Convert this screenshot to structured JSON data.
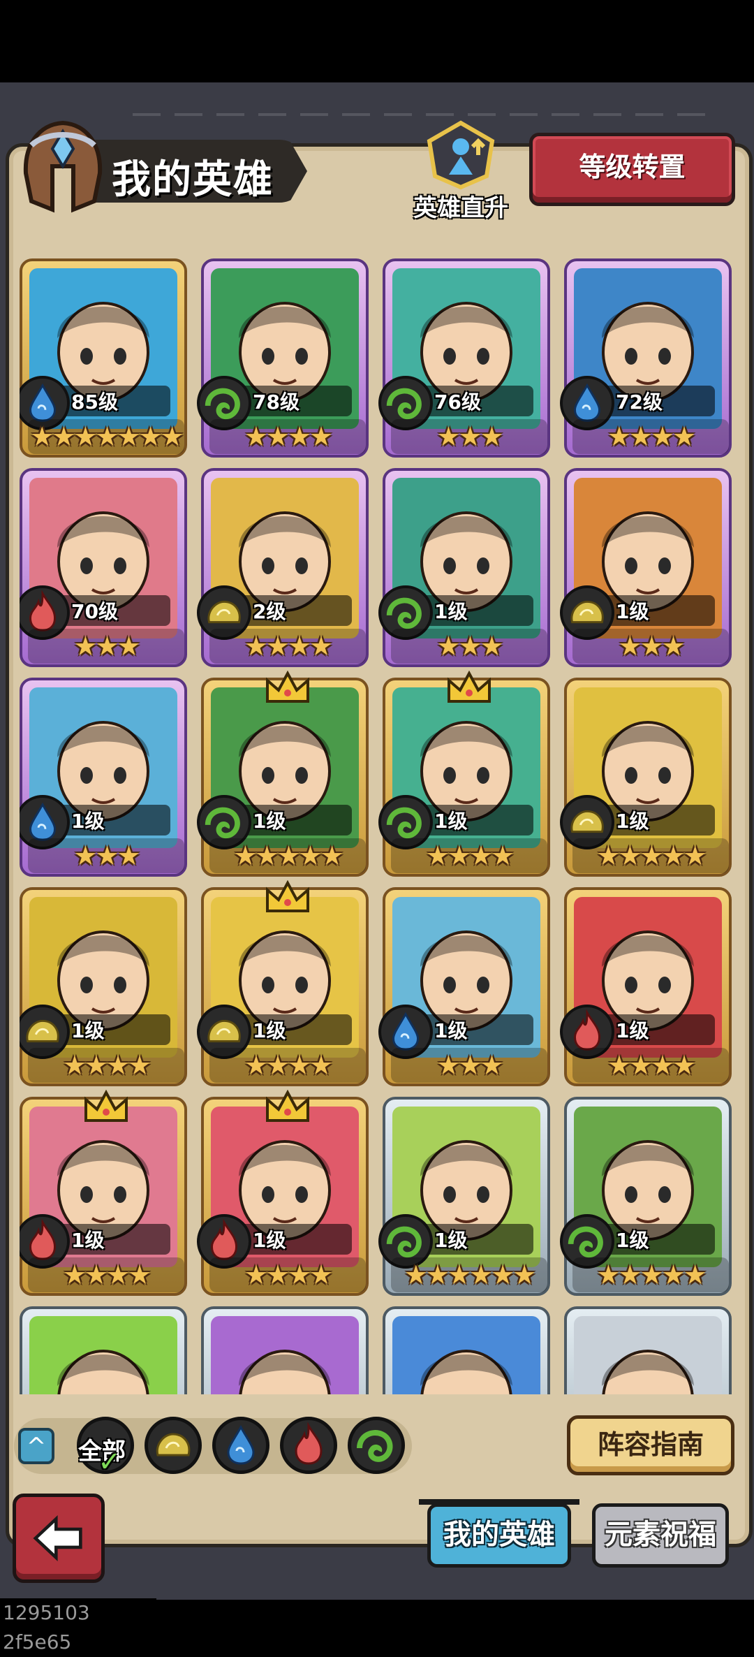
{
  "header": {
    "title": "我的英雄",
    "hero_upgrade_label": "英雄直升",
    "level_transfer_label": "等级转置"
  },
  "colors": {
    "water": "#3f8fd8",
    "nature": "#5fb83a",
    "fire": "#e05a5a",
    "earth": "#d8c04a",
    "accent_red": "#b3333d",
    "tab_active": "#4fb2d8"
  },
  "heroes": [
    {
      "level_label": "85级",
      "element": "water",
      "stars": "★★★★★★★",
      "frame": "gold",
      "crown": false,
      "bg": "#3ea7d8"
    },
    {
      "level_label": "78级",
      "element": "nature",
      "stars": "★★★★",
      "frame": "purple",
      "crown": false,
      "bg": "#3c9c5a"
    },
    {
      "level_label": "76级",
      "element": "nature",
      "stars": "★★★",
      "frame": "purple",
      "crown": false,
      "bg": "#44b0a0"
    },
    {
      "level_label": "72级",
      "element": "water",
      "stars": "★★★★",
      "frame": "purple",
      "crown": false,
      "bg": "#3e86c8"
    },
    {
      "level_label": "70级",
      "element": "fire",
      "stars": "★★★",
      "frame": "purple",
      "crown": false,
      "bg": "#e07a8a"
    },
    {
      "level_label": "2级",
      "element": "earth",
      "stars": "★★★★",
      "frame": "purple",
      "crown": false,
      "bg": "#e2b84a"
    },
    {
      "level_label": "1级",
      "element": "nature",
      "stars": "★★★",
      "frame": "purple",
      "crown": false,
      "bg": "#3da08a"
    },
    {
      "level_label": "1级",
      "element": "earth",
      "stars": "★★★",
      "frame": "purple",
      "crown": false,
      "bg": "#d9863a"
    },
    {
      "level_label": "1级",
      "element": "water",
      "stars": "★★★",
      "frame": "purple",
      "crown": false,
      "bg": "#5bb0d8"
    },
    {
      "level_label": "1级",
      "element": "nature",
      "stars": "★★★★★",
      "frame": "gold",
      "crown": true,
      "bg": "#4a9a4a"
    },
    {
      "level_label": "1级",
      "element": "nature",
      "stars": "★★★★",
      "frame": "gold",
      "crown": true,
      "bg": "#46b090"
    },
    {
      "level_label": "1级",
      "element": "earth",
      "stars": "★★★★★",
      "frame": "gold",
      "crown": false,
      "bg": "#e0c040"
    },
    {
      "level_label": "1级",
      "element": "earth",
      "stars": "★★★★",
      "frame": "gold",
      "crown": false,
      "bg": "#d8b838"
    },
    {
      "level_label": "1级",
      "element": "earth",
      "stars": "★★★★",
      "frame": "gold",
      "crown": true,
      "bg": "#e6c446"
    },
    {
      "level_label": "1级",
      "element": "water",
      "stars": "★★★",
      "frame": "gold",
      "crown": false,
      "bg": "#6ab8d8"
    },
    {
      "level_label": "1级",
      "element": "fire",
      "stars": "★★★★",
      "frame": "gold",
      "crown": false,
      "bg": "#d84a4a"
    },
    {
      "level_label": "1级",
      "element": "fire",
      "stars": "★★★★",
      "frame": "gold",
      "crown": true,
      "bg": "#e07a90"
    },
    {
      "level_label": "1级",
      "element": "fire",
      "stars": "★★★★",
      "frame": "gold",
      "crown": true,
      "bg": "#e05a6a"
    },
    {
      "level_label": "1级",
      "element": "nature",
      "stars": "★★★★★★",
      "frame": "silver",
      "crown": false,
      "bg": "#a8d05a"
    },
    {
      "level_label": "1级",
      "element": "nature",
      "stars": "★★★★★",
      "frame": "silver",
      "crown": false,
      "bg": "#6aa84a"
    },
    {
      "level_label": "",
      "element": "",
      "stars": "",
      "frame": "silver",
      "crown": false,
      "bg": "#8ad04a"
    },
    {
      "level_label": "",
      "element": "",
      "stars": "",
      "frame": "silver",
      "crown": false,
      "bg": "#a86ad0"
    },
    {
      "level_label": "",
      "element": "",
      "stars": "",
      "frame": "silver",
      "crown": false,
      "bg": "#4a8ad8"
    },
    {
      "level_label": "",
      "element": "",
      "stars": "",
      "frame": "silver",
      "crown": false,
      "bg": "#c8d0d8"
    }
  ],
  "filters": {
    "all_label": "全部",
    "items": [
      "all-filter",
      "earth-filter",
      "water-filter",
      "fire-filter",
      "nature-filter"
    ]
  },
  "lineup_guide_label": "阵容指南",
  "tabs": {
    "my_heroes": "我的英雄",
    "element_blessing": "元素祝福"
  },
  "debug_id": "1295103 2f5e65"
}
